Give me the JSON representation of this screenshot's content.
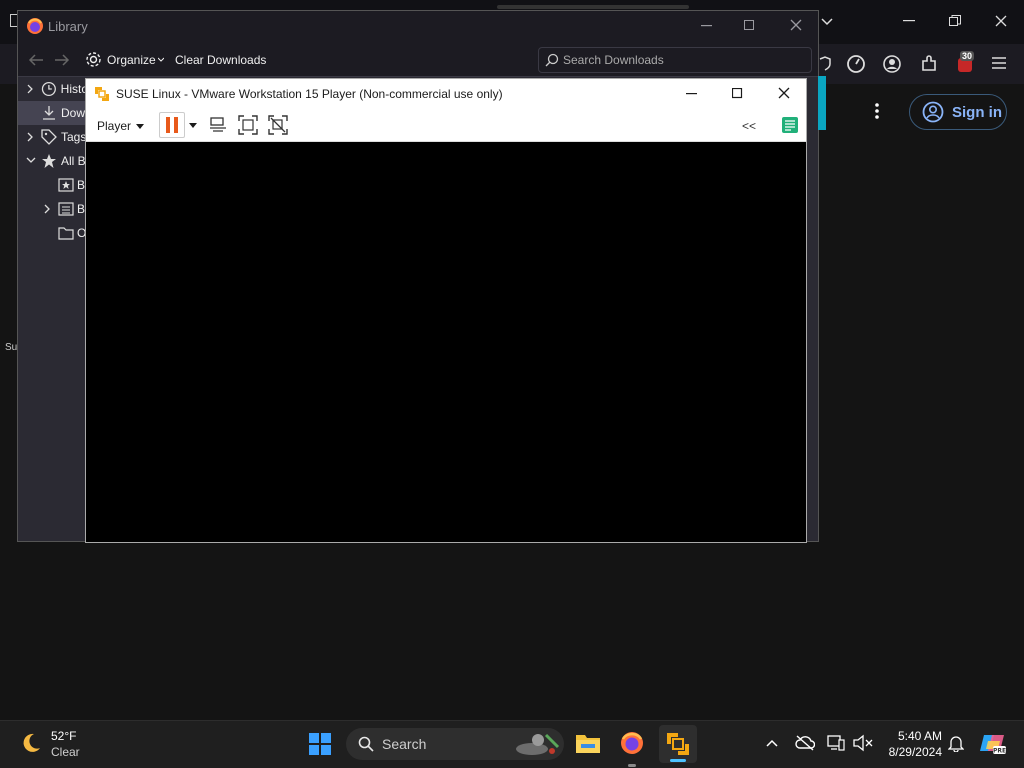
{
  "browser": {
    "sign_in_label": "Sign in",
    "side_text": "Su",
    "ext_badge": "30"
  },
  "library": {
    "title": "Library",
    "toolbar": {
      "organize_label": "Organize",
      "clear_downloads_label": "Clear Downloads",
      "search_placeholder": "Search Downloads"
    },
    "tree": [
      {
        "label": "Histo"
      },
      {
        "label": "Dow"
      },
      {
        "label": "Tags"
      },
      {
        "label": "All B"
      },
      {
        "label": "B"
      },
      {
        "label": "B"
      },
      {
        "label": "O"
      }
    ]
  },
  "vmware": {
    "title": "SUSE Linux - VMware Workstation 15 Player (Non-commercial use only)",
    "player_menu_label": "Player",
    "collapse_label": "<<"
  },
  "taskbar": {
    "weather_temp": "52°F",
    "weather_cond": "Clear",
    "search_label": "Search",
    "time": "5:40 AM",
    "date": "8/29/2024"
  },
  "colors": {
    "vmware_accent": "#e8591a",
    "teal_strip": "#0aa6c2",
    "sign_in_blue": "#8ab4f8"
  }
}
